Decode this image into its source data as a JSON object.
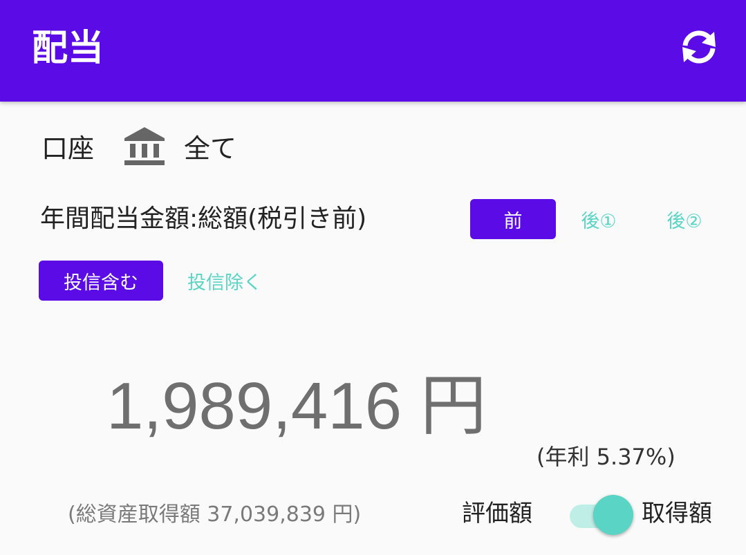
{
  "appbar": {
    "title": "配当",
    "refresh_icon": "refresh-icon"
  },
  "account": {
    "label": "口座",
    "icon": "bank-icon",
    "value": "全て"
  },
  "dividend": {
    "label": "年間配当金額:総額(税引き前)",
    "tax_options": [
      "前",
      "後①",
      "後②"
    ],
    "tax_selected": "前",
    "fund_options": [
      "投信含む",
      "投信除く"
    ],
    "fund_selected": "投信含む"
  },
  "summary": {
    "amount": "1,989,416 円",
    "yield": "(年利 5.37%)",
    "total_cost": "(総資産取得額 37,039,839 円)"
  },
  "basis_toggle": {
    "left_label": "評価額",
    "right_label": "取得額",
    "on": true
  },
  "colors": {
    "primary": "#5b0ce6",
    "accent": "#5ad4c4",
    "accent_light": "#bfeee7"
  }
}
